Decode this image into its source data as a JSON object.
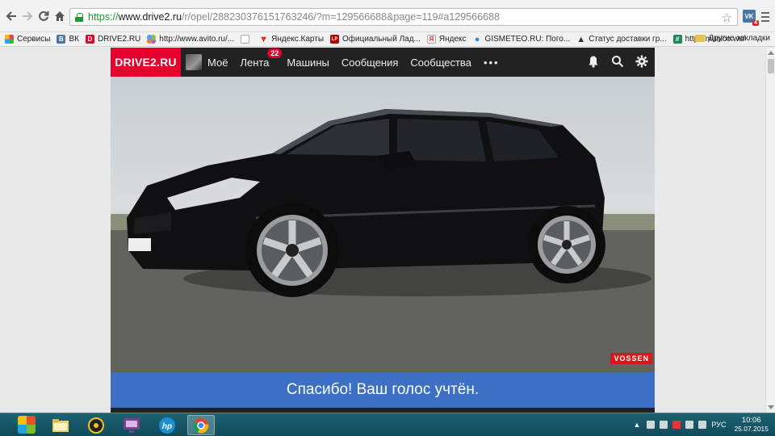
{
  "browser": {
    "url_scheme": "https://",
    "url_domain": "www.drive2.ru",
    "url_path": "/r/opel/288230376151763246/?m=129566688&page=119#a129566688",
    "vk_extension_label": "VK",
    "vk_extension_badge": "4"
  },
  "bookmarks": [
    {
      "label": "Сервисы",
      "icon": "apps-icon",
      "color": "#e44"
    },
    {
      "label": "ВК",
      "icon": "vk-icon",
      "color": "#4a76a8"
    },
    {
      "label": "DRIVE2.RU",
      "icon": "drive2-icon",
      "color": "#e6002b"
    },
    {
      "label": "http://www.avito.ru/...",
      "icon": "avito-icon",
      "color": "#5aa0e0"
    },
    {
      "label": "",
      "icon": "blank-page-icon",
      "color": "#bbb"
    },
    {
      "label": "Яндекс.Карты",
      "icon": "map-pin-icon",
      "color": "#e22"
    },
    {
      "label": "Официальный Лад...",
      "icon": "lp-icon",
      "color": "#b00"
    },
    {
      "label": "Яндекс",
      "icon": "yandex-icon",
      "color": "#bbb"
    },
    {
      "label": "GISMETEO.RU: Пого...",
      "icon": "gismeteo-icon",
      "color": "#2a8de0"
    },
    {
      "label": "Статус доставки гр...",
      "icon": "warning-icon",
      "color": "#333"
    },
    {
      "label": "http://musico.ws/",
      "icon": "musico-icon",
      "color": "#1c8a5a"
    }
  ],
  "bookmarks_other": "Другие закладки",
  "site": {
    "logo": "DRIVE2.RU",
    "nav": {
      "my": "Моё",
      "feed": "Лента",
      "feed_badge": "22",
      "cars": "Машины",
      "messages": "Сообщения",
      "communities": "Сообщества",
      "more": "•••"
    }
  },
  "photo": {
    "plate": "Н037УВ 93",
    "watermark": "VOSSEN"
  },
  "vote_message": "Спасибо! Ваш голос учтён.",
  "taskbar": {
    "language": "РУС",
    "time": "10:06",
    "date": "25.07.2015"
  }
}
